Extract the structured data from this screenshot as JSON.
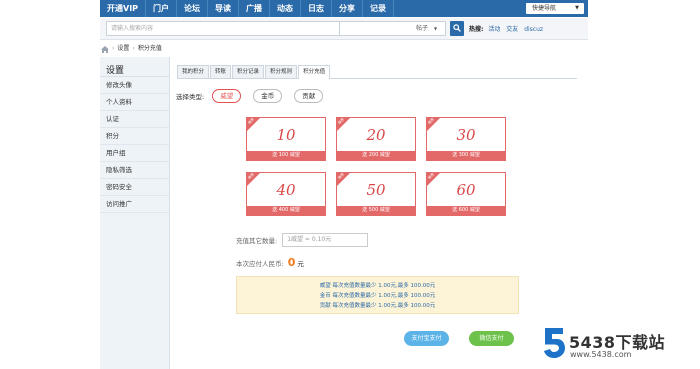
{
  "topnav": {
    "items": [
      "开通VIP",
      "门户",
      "论坛",
      "导读",
      "广播",
      "动态",
      "日志",
      "分享",
      "记录"
    ],
    "quick_nav": "快捷导航"
  },
  "search": {
    "placeholder": "请输入搜索内容",
    "type": "帖子",
    "hot_label": "热搜:",
    "hot_links": [
      "活动",
      "交友",
      "discuz"
    ]
  },
  "breadcrumb": [
    "设置",
    "积分充值"
  ],
  "sidebar": {
    "title": "设置",
    "items": [
      "修改头像",
      "个人资料",
      "认证",
      "积分",
      "用户组",
      "隐私筛选",
      "密码安全",
      "访问推广"
    ]
  },
  "tabs": [
    "我的积分",
    "转账",
    "积分记录",
    "积分规则",
    "积分充值"
  ],
  "active_tab": 4,
  "type_select": {
    "label": "选择类型:",
    "options": [
      "威望",
      "金币",
      "贡献"
    ],
    "selected": 0
  },
  "packages": [
    {
      "ribbon": "推荐",
      "amount": "10",
      "foot": "送 100 威望"
    },
    {
      "ribbon": "推荐",
      "amount": "20",
      "foot": "送 200 威望"
    },
    {
      "ribbon": "推荐",
      "amount": "30",
      "foot": "送 300 威望"
    },
    {
      "ribbon": "推荐",
      "amount": "40",
      "foot": "送 400 威望"
    },
    {
      "ribbon": "推荐",
      "amount": "50",
      "foot": "送 500 威望"
    },
    {
      "ribbon": "推荐",
      "amount": "60",
      "foot": "送 600 威望"
    }
  ],
  "other": {
    "label": "充值其它数量:",
    "placeholder": "1威望 = 0.10元"
  },
  "payable": {
    "label": "本次应付人民币:",
    "amount": "0",
    "unit": "元"
  },
  "notice": [
    "威望 每次充值数量最少 1.00元,最多 100.00元",
    "金币 每次充值数量最少 1.00元,最多 100.00元",
    "贡献 每次充值数量最少 1.00元,最多 100.00元"
  ],
  "buttons": {
    "alipay": "支付宝支付",
    "wechat": "微信支付"
  },
  "watermark": {
    "title": "5438下载站",
    "url": "www.5438.com"
  },
  "colors": {
    "nav_blue": "#2b6aa8",
    "card_red": "#e36868",
    "pay_orange": "#f07a1a",
    "alipay_blue": "#5cb3e8",
    "wechat_green": "#6cc24a"
  }
}
